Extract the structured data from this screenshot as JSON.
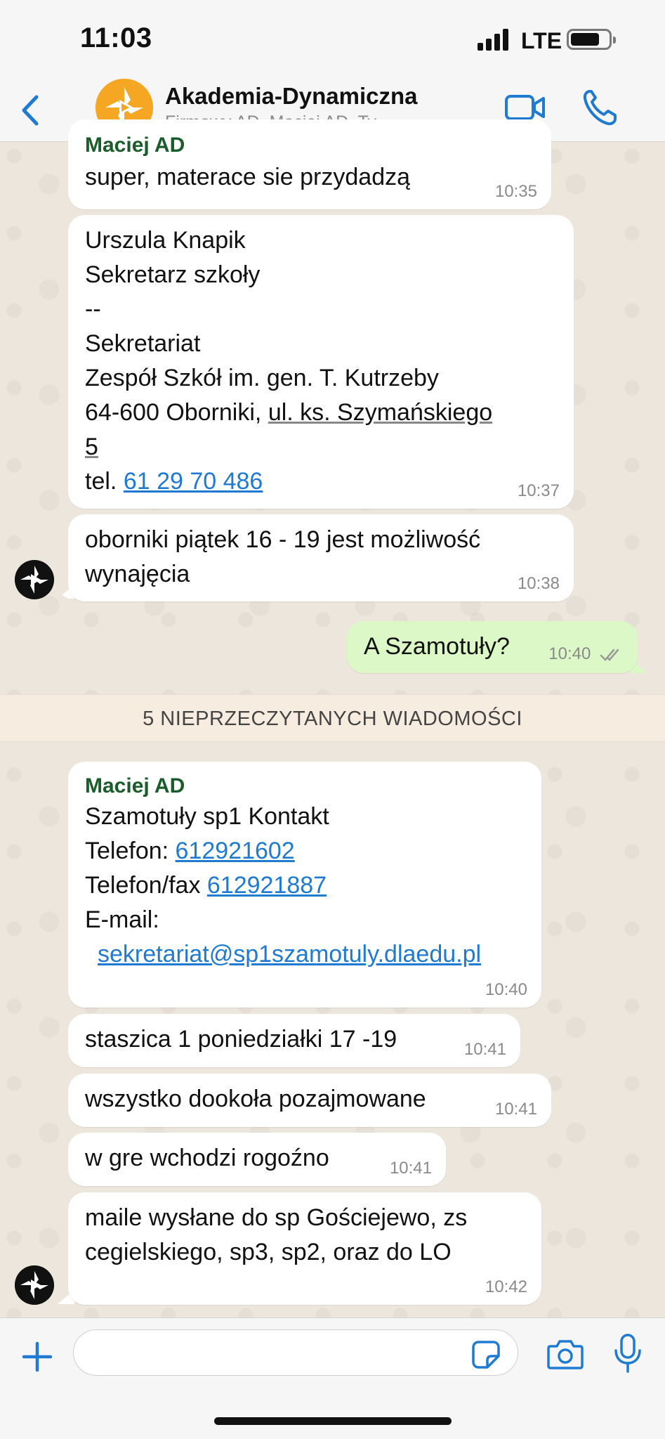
{
  "status_bar": {
    "time": "11:03",
    "network": "LTE",
    "battery_level": 0.7
  },
  "header": {
    "back_icon": "chevron-left-icon",
    "title": "Akademia-Dynamiczna",
    "subtitle": "Firmowy AD, Maciej AD, Ty",
    "video_icon": "video-camera-icon",
    "call_icon": "phone-icon",
    "accent_color": "#1f7ad4"
  },
  "messages": {
    "m1": {
      "sender": "Maciej AD",
      "text": "super, materace sie przydadzą",
      "time": "10:35"
    },
    "m2": {
      "line1": "Urszula Knapik",
      "line2": "Sekretarz szkoły",
      "line3": "--",
      "line4": "Sekretariat",
      "line5": "Zespół Szkół im. gen. T. Kutrzeby",
      "line6_prefix": "64-600 Oborniki, ",
      "line6_address": "ul. ks. Szymańskiego",
      "line7_address": "5",
      "tel_prefix": "tel. ",
      "tel": "61 29 70 486",
      "time": "10:37"
    },
    "m3": {
      "line1": "oborniki piątek 16 - 19 jest możliwość",
      "line2": "wynajęcia",
      "time": "10:38"
    },
    "m4": {
      "text": "A Szamotuły?",
      "time": "10:40",
      "status_icon": "double-check-icon"
    },
    "m5": {
      "sender": "Maciej AD",
      "line1": "Szamotuły sp1 Kontakt",
      "phone_prefix": "Telefon: ",
      "phone": "612921602",
      "fax_prefix": "Telefon/fax ",
      "fax": "612921887",
      "email_label": "E-mail:",
      "email": "sekretariat@sp1szamotuly.dlaedu.pl",
      "time": "10:40"
    },
    "m6": {
      "text": "staszica 1 poniedziałki 17 -19",
      "time": "10:41"
    },
    "m7": {
      "text": "wszystko dookoła pozajmowane",
      "time": "10:41"
    },
    "m8": {
      "text": "w gre wchodzi rogoźno",
      "time": "10:41"
    },
    "m9": {
      "line1": "maile wysłane do sp Gościejewo, zs",
      "line2": "cegielskiego, sp3, sp2, oraz do LO",
      "time": "10:42"
    }
  },
  "unread_banner": "5 NIEPRZECZYTANYCH WIADOMOŚCI",
  "input_bar": {
    "plus_icon": "plus-icon",
    "text_value": "",
    "sticker_icon": "sticker-icon",
    "camera_icon": "camera-icon",
    "mic_icon": "microphone-icon"
  },
  "colors": {
    "outgoing_bubble": "#dcf8c6",
    "incoming_bubble": "#ffffff",
    "sender_name": "#1a5c2a",
    "link": "#1f7ad4",
    "group_avatar": "#f5a623"
  }
}
